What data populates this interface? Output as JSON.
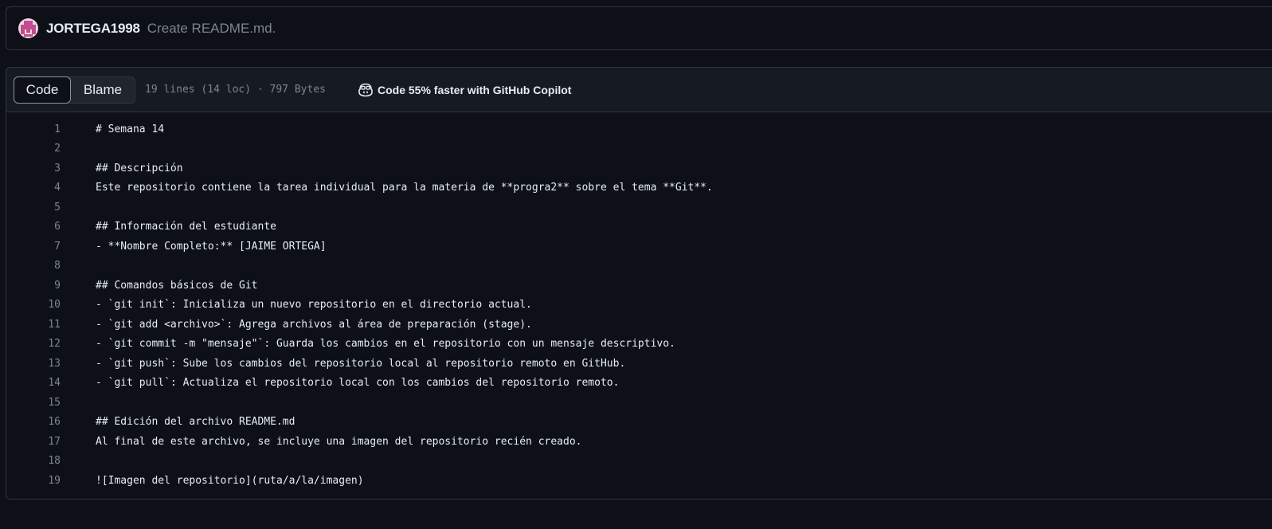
{
  "commit": {
    "author": "JORTEGA1998",
    "message": "Create README.md."
  },
  "file_header": {
    "tabs": [
      "Code",
      "Blame"
    ],
    "active_tab": "Code",
    "meta": "19 lines (14 loc) · 797 Bytes",
    "copilot_label": "Code 55% faster with GitHub Copilot"
  },
  "code": {
    "lines": [
      {
        "num": "1",
        "text": "# Semana 14"
      },
      {
        "num": "2",
        "text": ""
      },
      {
        "num": "3",
        "text": "## Descripción"
      },
      {
        "num": "4",
        "text": "Este repositorio contiene la tarea individual para la materia de **progra2** sobre el tema **Git**."
      },
      {
        "num": "5",
        "text": ""
      },
      {
        "num": "6",
        "text": "## Información del estudiante"
      },
      {
        "num": "7",
        "text": "- **Nombre Completo:** [JAIME ORTEGA]"
      },
      {
        "num": "8",
        "text": ""
      },
      {
        "num": "9",
        "text": "## Comandos básicos de Git"
      },
      {
        "num": "10",
        "text": "- `git init`: Inicializa un nuevo repositorio en el directorio actual."
      },
      {
        "num": "11",
        "text": "- `git add <archivo>`: Agrega archivos al área de preparación (stage)."
      },
      {
        "num": "12",
        "text": "- `git commit -m \"mensaje\"`: Guarda los cambios en el repositorio con un mensaje descriptivo."
      },
      {
        "num": "13",
        "text": "- `git push`: Sube los cambios del repositorio local al repositorio remoto en GitHub."
      },
      {
        "num": "14",
        "text": "- `git pull`: Actualiza el repositorio local con los cambios del repositorio remoto."
      },
      {
        "num": "15",
        "text": ""
      },
      {
        "num": "16",
        "text": "## Edición del archivo README.md"
      },
      {
        "num": "17",
        "text": "Al final de este archivo, se incluye una imagen del repositorio recién creado."
      },
      {
        "num": "18",
        "text": ""
      },
      {
        "num": "19",
        "text": "![Imagen del repositorio](ruta/a/la/imagen)"
      }
    ]
  },
  "colors": {
    "background": "#0d1117",
    "header_background": "#161b22",
    "border": "#30363d",
    "muted_text": "#7d8590",
    "text": "#e6edf3",
    "avatar_accent": "#c24d8f"
  }
}
